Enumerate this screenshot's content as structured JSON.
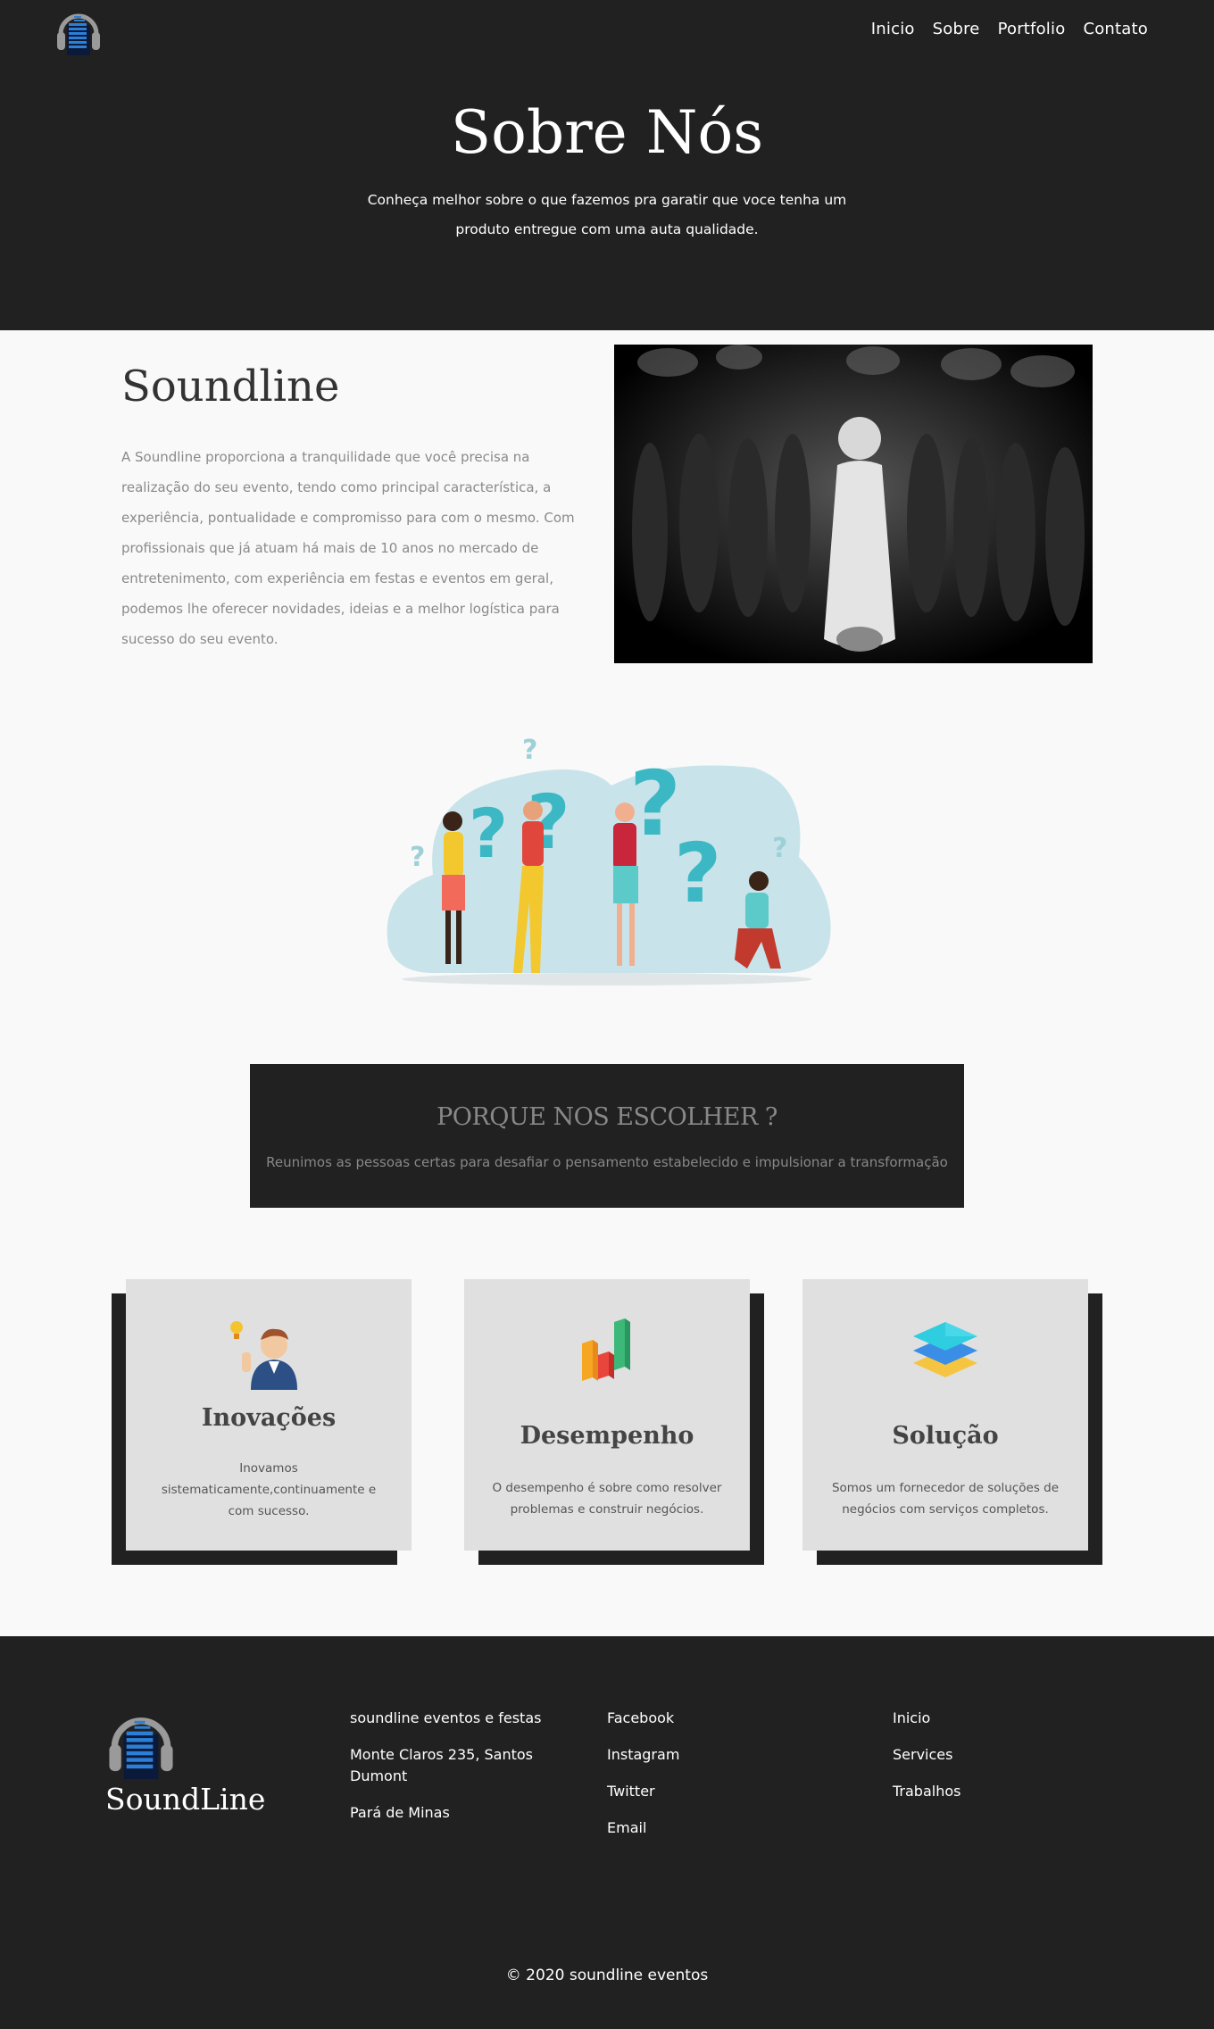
{
  "nav": {
    "items": [
      "Inicio",
      "Sobre",
      "Portfolio",
      "Contato"
    ]
  },
  "hero": {
    "title": "Sobre Nós",
    "subtitle": "Conheça melhor sobre o que fazemos pra garatir que voce tenha um produto entregue com uma auta qualidade."
  },
  "about": {
    "title": "Soundline",
    "text": "A Soundline proporciona a tranquilidade que você precisa na realização do seu evento, tendo como principal característica, a experiência, pontualidade e compromisso para com o mesmo. Com profissionais que já atuam há mais de 10 anos no mercado de entretenimento, com experiência em festas e eventos em geral, podemos lhe oferecer novidades, ideias e a melhor logística para sucesso do seu evento."
  },
  "why": {
    "title": "PORQUE NOS ESCOLHER ?",
    "subtitle": "Reunimos as pessoas certas para desafiar o pensamento estabelecido e impulsionar a transformação"
  },
  "cards": [
    {
      "title": "Inovações",
      "text": "Inovamos sistematicamente,continuamente e com sucesso.",
      "icon": "idea-person-icon"
    },
    {
      "title": "Desempenho",
      "text": "O desempenho é sobre como resolver problemas e construir negócios.",
      "icon": "bar-chart-icon"
    },
    {
      "title": "Solução",
      "text": "Somos um fornecedor de soluções de negócios com serviços completos.",
      "icon": "layers-icon"
    }
  ],
  "footer": {
    "brand": "SoundLine",
    "address": [
      "soundline eventos e festas",
      "Monte Claros 235, Santos Dumont",
      "Pará de Minas"
    ],
    "social": [
      "Facebook",
      "Instagram",
      "Twitter",
      "Email"
    ],
    "links": [
      "Inicio",
      "Services",
      "Trabalhos"
    ],
    "copyright": "© 2020 soundline eventos"
  },
  "colors": {
    "dark": "#212121",
    "light": "#f9f9f9",
    "card": "#e0e0e0",
    "accent": "#2a5fb0"
  }
}
